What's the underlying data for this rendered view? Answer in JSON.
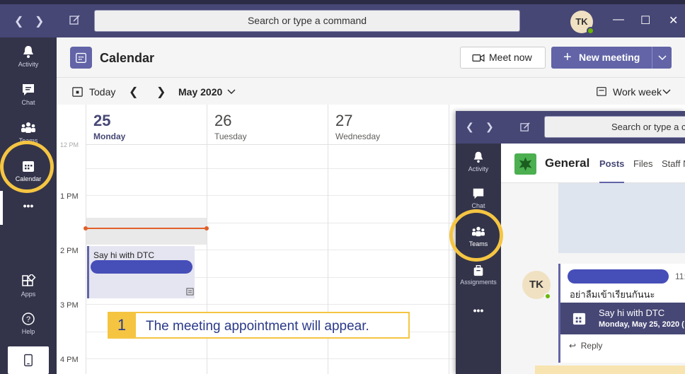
{
  "topbar": {
    "search_placeholder": "Search or type a command",
    "avatar_initials": "TK",
    "minimize": "—",
    "maximize": "☐",
    "close": "✕"
  },
  "rail": {
    "items": [
      {
        "label": "Activity",
        "icon": "bell-icon"
      },
      {
        "label": "Chat",
        "icon": "chat-icon"
      },
      {
        "label": "Teams",
        "icon": "teams-icon"
      },
      {
        "label": "Calendar",
        "icon": "calendar-icon"
      },
      {
        "label": "•••",
        "icon": "more-icon"
      },
      {
        "label": "Apps",
        "icon": "apps-icon"
      },
      {
        "label": "Help",
        "icon": "help-icon"
      }
    ]
  },
  "header": {
    "title": "Calendar",
    "meet_now": "Meet now",
    "new_meeting": "New meeting"
  },
  "toolbar": {
    "today": "Today",
    "month": "May 2020",
    "view": "Work week"
  },
  "grid": {
    "days": [
      {
        "num": "25",
        "name": "Monday",
        "today": true
      },
      {
        "num": "26",
        "name": "Tuesday",
        "today": false
      },
      {
        "num": "27",
        "name": "Wednesday",
        "today": false
      }
    ],
    "times": [
      "1 PM",
      "2 PM",
      "3 PM",
      "4 PM"
    ],
    "event_title": "Say hi with DTC"
  },
  "callout": {
    "number": "1",
    "text": "The meeting appointment will appear."
  },
  "overlay": {
    "search_placeholder": "Search or type a c",
    "rail": [
      {
        "label": "Activity",
        "icon": "bell-icon"
      },
      {
        "label": "Chat",
        "icon": "chat-icon"
      },
      {
        "label": "Teams",
        "icon": "teams-icon"
      },
      {
        "label": "Assignments",
        "icon": "assignments-icon"
      },
      {
        "label": "•••",
        "icon": "more-icon"
      }
    ],
    "channel": "General",
    "tabs": [
      "Posts",
      "Files",
      "Staff N"
    ],
    "avatar_initials": "TK",
    "time": "11:",
    "message": "อย่าลืมเข้าเรียนกันนะ",
    "meeting_title": "Say hi with DTC",
    "meeting_date": "Monday, May 25, 2020 (",
    "reply": "Reply"
  },
  "colors": {
    "brand": "#464775",
    "accent": "#6264a7",
    "highlight": "#f5c542",
    "now_line": "#e0602a"
  }
}
